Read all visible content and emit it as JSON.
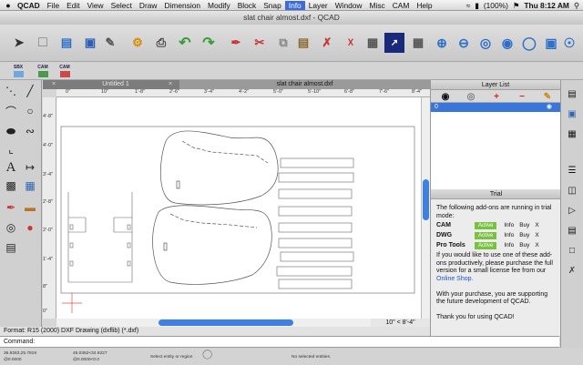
{
  "menubar": {
    "apple": "",
    "items": [
      "QCAD",
      "File",
      "Edit",
      "View",
      "Select",
      "Draw",
      "Dimension",
      "Modify",
      "Block",
      "Snap",
      "Info",
      "Layer",
      "Window",
      "Misc",
      "CAM",
      "Help"
    ],
    "battery": "(100%)",
    "clock": "Thu 8:12 AM"
  },
  "window": {
    "title": "slat chair almost.dxf - QCAD"
  },
  "toolbar2": {
    "sbx_label": "SBX",
    "cam_label_1": "CAM",
    "cam_label_2": "CAM"
  },
  "tabs": [
    {
      "label": "Untitled 1"
    },
    {
      "label": "slat chair almost.dxf"
    }
  ],
  "ruler": {
    "h": [
      "0\"",
      "10\"",
      "1'-8\"",
      "2'-6\"",
      "3'-4\"",
      "4'-2\"",
      "5'-0\"",
      "5'-10\"",
      "6'-8\"",
      "7'-6\"",
      "8'-4\""
    ],
    "v": [
      "4'-8\"",
      "4'-0\"",
      "3'-4\"",
      "2'-8\"",
      "2'-0\"",
      "1'-4\"",
      "8\"",
      "0\""
    ]
  },
  "grid_info": "10\" < 8'-4\"",
  "format_line": "Format: R15 (2000) DXF Drawing (dxflib) (*.dxf)",
  "command_label": "Command:",
  "status": {
    "coord_abs": "36.9263,25.7819",
    "coord_polar": "45.0362<34.9227",
    "coord_rel": "@0.0000",
    "coord_rel_polar": "@0.0000<0.0",
    "select_hint": "Select entity or region",
    "selected_entities": "No selected entities."
  },
  "layer_panel": {
    "title": "Layer List",
    "layers": [
      {
        "name": "0"
      }
    ]
  },
  "trial_panel": {
    "title": "Trial",
    "intro": "The following add-ons are running in trial mode:",
    "addons": [
      {
        "name": "CAM",
        "status": "Active",
        "info": "Info",
        "buy": "Buy",
        "close": "X"
      },
      {
        "name": "DWG",
        "status": "Active",
        "info": "Info",
        "buy": "Buy",
        "close": "X"
      },
      {
        "name": "Pro Tools",
        "status": "Active",
        "info": "Info",
        "buy": "Buy",
        "close": "X"
      }
    ],
    "buy_text": "If you would like to use one of these add-ons productively, please purchase the full version for a small license fee from our",
    "shop_link": "Online Shop.",
    "support_text": "With your purchase, you are supporting the future development of QCAD.",
    "thanks": "Thank you for using QCAD!"
  },
  "colors": {
    "accent": "#3876d9",
    "active_badge": "#7ac142",
    "link": "#2250c8"
  }
}
